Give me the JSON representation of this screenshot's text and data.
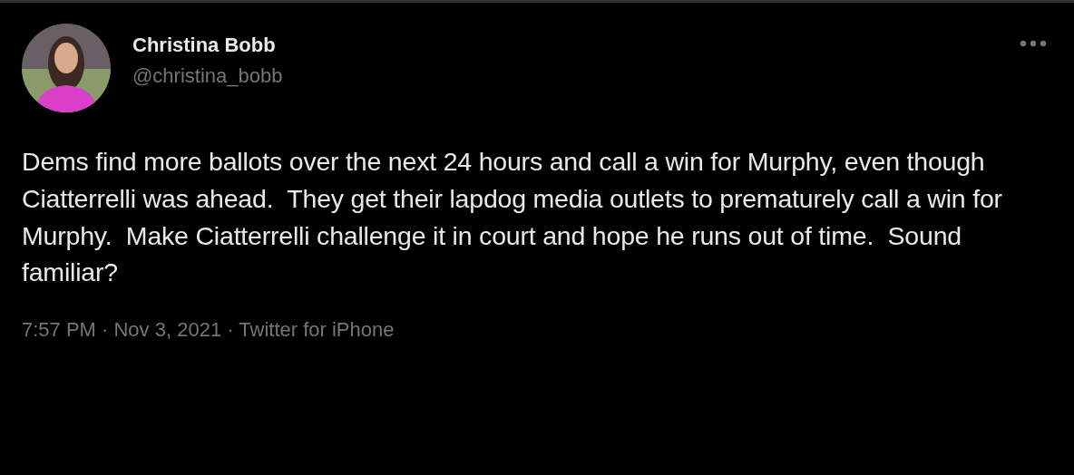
{
  "tweet": {
    "author": {
      "name": "Christina Bobb",
      "handle": "@christina_bobb"
    },
    "text": "Dems find more ballots over the next 24 hours and call a win for Murphy, even though Ciatterrelli was ahead.  They get their lapdog media outlets to prematurely call a win for Murphy.  Make Ciatterrelli challenge it in court and hope he runs out of time.  Sound familiar?",
    "meta": "7:57 PM · Nov 3, 2021 · Twitter for iPhone"
  }
}
